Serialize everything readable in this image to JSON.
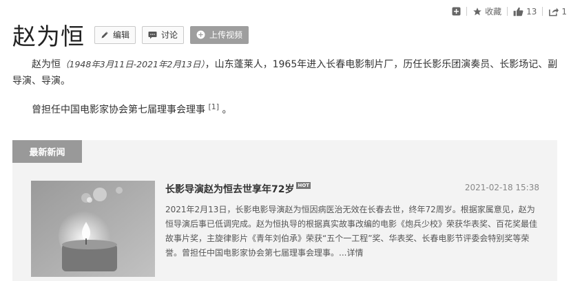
{
  "toolbar": {
    "add_count": "",
    "favorite_label": "收藏",
    "like_count": "13",
    "share_count": "1"
  },
  "header": {
    "title": "赵为恒",
    "edit_label": "编辑",
    "discuss_label": "讨论",
    "upload_label": "上传视频"
  },
  "intro": {
    "name": "赵为恒",
    "dates": "（1948年3月11日-2021年2月13日）",
    "text": "，山东蓬莱人，1965年进入长春电影制片厂，历任长影乐团演奏员、长影场记、副导演、导演。",
    "para2": "曾担任中国电影家协会第七届理事会理事",
    "ref": "[1]",
    "para2_end": "。"
  },
  "news": {
    "tab_label": "最新新闻",
    "items": [
      {
        "title": "长影导演赵为恒去世享年72岁",
        "badge": "HOT",
        "date": "2021-02-18 15:38",
        "summary": "2021年2月13日，长影电影导演赵为恒因病医治无效在长春去世，终年72周岁。根据家属意见，赵为恒导演后事已低调完成。赵为恒执导的根据真实故事改编的电影《炮兵少校》荣获华表奖、百花奖最佳故事片奖，主旋律影片《青年刘伯承》荣获“五个一工程”奖、华表奖、长春电影节评委会特别奖等荣誉。曾担任中国电影家协会第七届理事会理事。",
        "more_label": "...详情"
      }
    ]
  },
  "icons": [
    "add-icon",
    "star-icon",
    "thumbs-up-icon",
    "share-icon",
    "pencil-icon",
    "comment-icon",
    "plus-circle-icon"
  ],
  "colors": {
    "tab_bg": "#999999",
    "news_bg": "#f3f3f3",
    "upload_btn": "#9e9e9e"
  }
}
